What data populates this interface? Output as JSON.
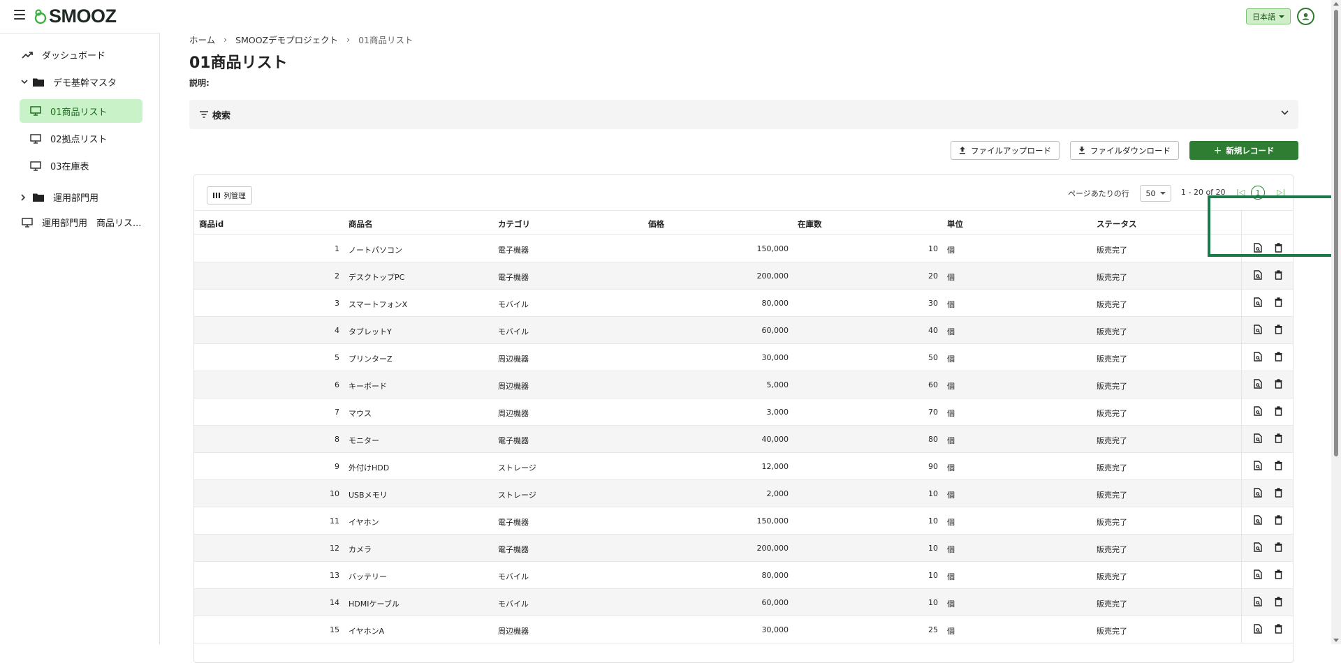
{
  "app": {
    "logo_text": "SMOOZ",
    "language": "日本語",
    "accent_color": "#2e7d32"
  },
  "sidebar": {
    "items": [
      {
        "label": "ダッシュボード",
        "icon": "trending-up-icon"
      },
      {
        "label": "デモ基幹マスタ",
        "icon": "folder-icon",
        "expanded": true
      },
      {
        "label": "01商品リスト",
        "icon": "monitor-icon",
        "active": true
      },
      {
        "label": "02拠点リスト",
        "icon": "monitor-icon"
      },
      {
        "label": "03在庫表",
        "icon": "monitor-icon"
      },
      {
        "label": "運用部門用",
        "icon": "folder-icon",
        "expanded": false
      },
      {
        "label": "運用部門用　商品リス...",
        "icon": "monitor-icon"
      }
    ]
  },
  "breadcrumb": {
    "home": "ホーム",
    "project": "SMOOZデモプロジェクト",
    "current": "01商品リスト"
  },
  "page": {
    "title": "01商品リスト",
    "description_label": "説明:",
    "search_label": "検索"
  },
  "actions": {
    "upload": "ファイルアップロード",
    "download": "ファイルダウンロード",
    "new_record": "新規レコード"
  },
  "table": {
    "column_manage": "列管理",
    "rows_per_page_label": "ページあたりの行",
    "rows_per_page": "50",
    "range_text": "1 - 20 of 20",
    "current_page": "1",
    "columns": [
      "商品id",
      "商品名",
      "カテゴリ",
      "価格",
      "在庫数",
      "単位",
      "ステータス"
    ],
    "rows": [
      {
        "id": "1",
        "name": "ノートパソコン",
        "category": "電子機器",
        "price": "150,000",
        "stock": "10",
        "unit": "個",
        "status": "販売完了"
      },
      {
        "id": "2",
        "name": "デスクトップPC",
        "category": "電子機器",
        "price": "200,000",
        "stock": "20",
        "unit": "個",
        "status": "販売完了"
      },
      {
        "id": "3",
        "name": "スマートフォンX",
        "category": "モバイル",
        "price": "80,000",
        "stock": "30",
        "unit": "個",
        "status": "販売完了"
      },
      {
        "id": "4",
        "name": "タブレットY",
        "category": "モバイル",
        "price": "60,000",
        "stock": "40",
        "unit": "個",
        "status": "販売完了"
      },
      {
        "id": "5",
        "name": "プリンターZ",
        "category": "周辺機器",
        "price": "30,000",
        "stock": "50",
        "unit": "個",
        "status": "販売完了"
      },
      {
        "id": "6",
        "name": "キーボード",
        "category": "周辺機器",
        "price": "5,000",
        "stock": "60",
        "unit": "個",
        "status": "販売完了"
      },
      {
        "id": "7",
        "name": "マウス",
        "category": "周辺機器",
        "price": "3,000",
        "stock": "70",
        "unit": "個",
        "status": "販売完了"
      },
      {
        "id": "8",
        "name": "モニター",
        "category": "電子機器",
        "price": "40,000",
        "stock": "80",
        "unit": "個",
        "status": "販売完了"
      },
      {
        "id": "9",
        "name": "外付けHDD",
        "category": "ストレージ",
        "price": "12,000",
        "stock": "90",
        "unit": "個",
        "status": "販売完了"
      },
      {
        "id": "10",
        "name": "USBメモリ",
        "category": "ストレージ",
        "price": "2,000",
        "stock": "10",
        "unit": "個",
        "status": "販売完了"
      },
      {
        "id": "11",
        "name": "イヤホン",
        "category": "電子機器",
        "price": "150,000",
        "stock": "10",
        "unit": "個",
        "status": "販売完了"
      },
      {
        "id": "12",
        "name": "カメラ",
        "category": "電子機器",
        "price": "200,000",
        "stock": "10",
        "unit": "個",
        "status": "販売完了"
      },
      {
        "id": "13",
        "name": "バッテリー",
        "category": "モバイル",
        "price": "80,000",
        "stock": "10",
        "unit": "個",
        "status": "販売完了"
      },
      {
        "id": "14",
        "name": "HDMIケーブル",
        "category": "モバイル",
        "price": "60,000",
        "stock": "10",
        "unit": "個",
        "status": "販売完了"
      },
      {
        "id": "15",
        "name": "イヤホンA",
        "category": "周辺機器",
        "price": "30,000",
        "stock": "25",
        "unit": "個",
        "status": "販売完了"
      }
    ]
  }
}
